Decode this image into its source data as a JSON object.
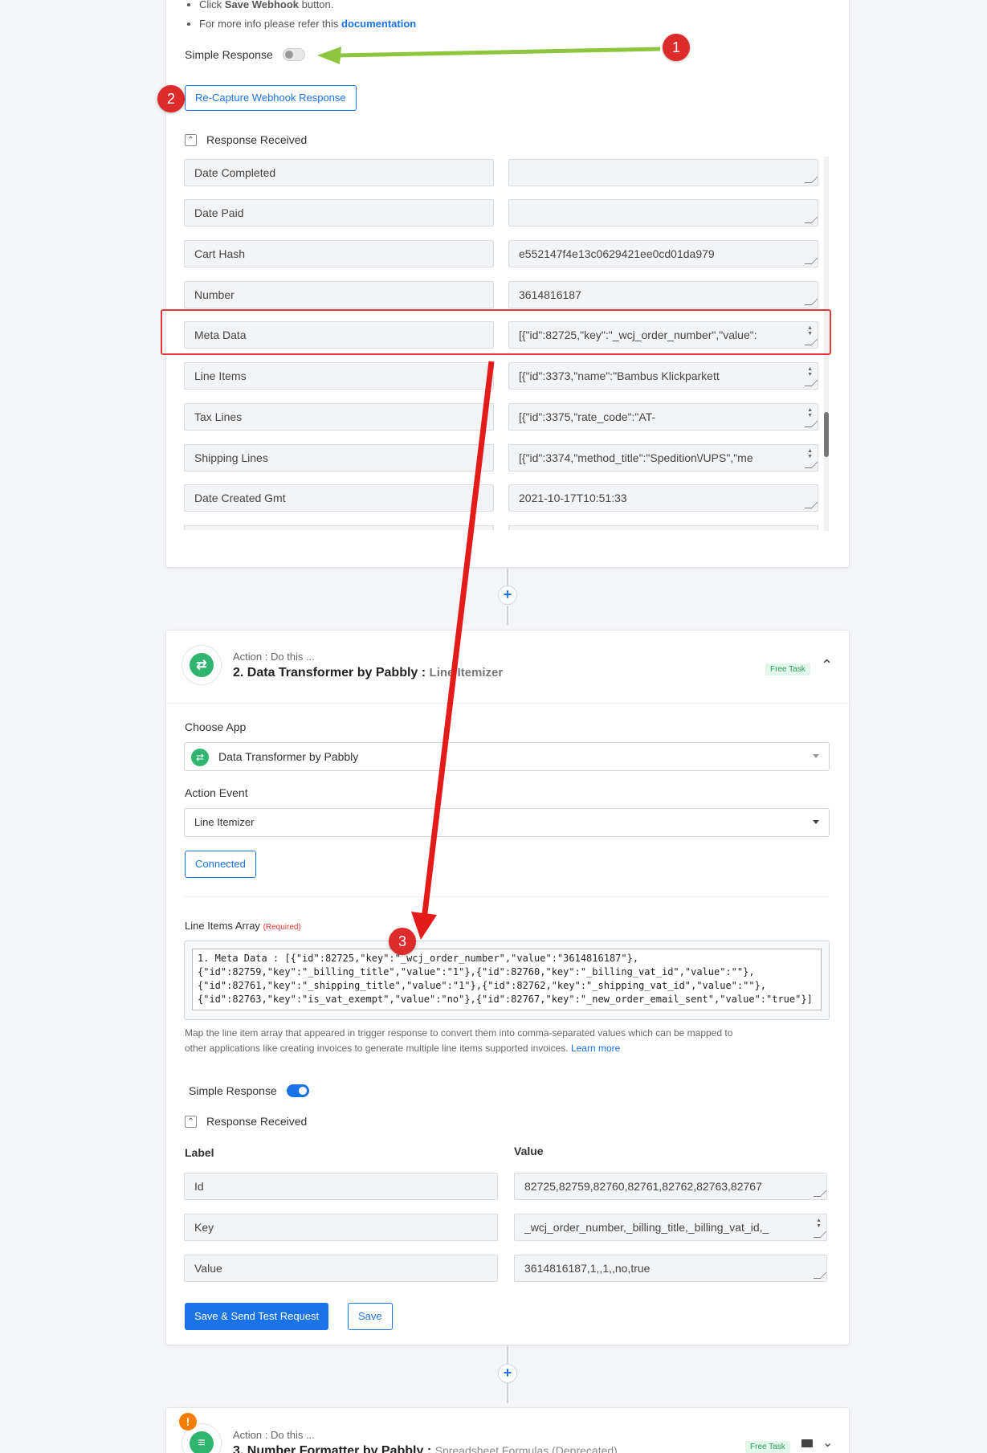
{
  "card1": {
    "bullets": [
      {
        "prefix": "Click ",
        "bold": "Save Webhook",
        "suffix": " button."
      },
      {
        "prefix": "For more info please refer this ",
        "link": "documentation"
      }
    ],
    "simple_response_label": "Simple Response",
    "simple_response_on": false,
    "recapture_button": "Re-Capture Webhook Response",
    "response_received_label": "Response Received",
    "fields": [
      {
        "label": "Date Completed",
        "value": ""
      },
      {
        "label": "Date Paid",
        "value": ""
      },
      {
        "label": "Cart Hash",
        "value": "e552147f4e13c0629421ee0cd01da979"
      },
      {
        "label": "Number",
        "value": "3614816187"
      },
      {
        "label": "Meta Data",
        "value": "[{\"id\":82725,\"key\":\"_wcj_order_number\",\"value\":"
      },
      {
        "label": "Line Items",
        "value": "[{\"id\":3373,\"name\":\"Bambus Klickparkett"
      },
      {
        "label": "Tax Lines",
        "value": "[{\"id\":3375,\"rate_code\":\"AT-"
      },
      {
        "label": "Shipping Lines",
        "value": "[{\"id\":3374,\"method_title\":\"Spedition\\/UPS\",\"me"
      },
      {
        "label": "Date Created Gmt",
        "value": "2021-10-17T10:51:33"
      }
    ]
  },
  "annotations": {
    "one": "1",
    "two": "2",
    "three": "3"
  },
  "action2": {
    "pre_title": "Action : Do this ...",
    "title_bold": "2. Data Transformer by Pabbly : ",
    "title_event": "Line Itemizer",
    "badge": "Free Task",
    "choose_app_label": "Choose App",
    "choose_app_value": "Data Transformer by Pabbly",
    "action_event_label": "Action Event",
    "action_event_value": "Line Itemizer",
    "connected_button": "Connected",
    "line_items_label": "Line Items Array",
    "required": "(Required)",
    "line_items_value": [
      "1. Meta Data : [{\"id\":82725,\"key\":\"_wcj_order_number\",\"value\":\"3614816187\"},",
      "{\"id\":82759,\"key\":\"_billing_title\",\"value\":\"1\"},{\"id\":82760,\"key\":\"_billing_vat_id\",\"value\":\"\"},",
      "{\"id\":82761,\"key\":\"_shipping_title\",\"value\":\"1\"},{\"id\":82762,\"key\":\"_shipping_vat_id\",\"value\":\"\"},",
      "{\"id\":82763,\"key\":\"is_vat_exempt\",\"value\":\"no\"},{\"id\":82767,\"key\":\"_new_order_email_sent\",\"value\":\"true\"}]"
    ],
    "help_text_1": "Map the line item array that appeared in trigger response to convert them into comma-separated values which can be mapped to",
    "help_text_2": "other applications like creating invoices to generate multiple line items supported invoices.",
    "learn_more": "Learn more",
    "simple_response_label": "Simple Response",
    "simple_response_on": true,
    "response_received_label": "Response Received",
    "label_header": "Label",
    "value_header": "Value",
    "rows": [
      {
        "label": "Id",
        "value": "82725,82759,82760,82761,82762,82763,82767"
      },
      {
        "label": "Key",
        "value": "_wcj_order_number,_billing_title,_billing_vat_id,_"
      },
      {
        "label": "Value",
        "value": "3614816187,1,,1,,no,true"
      }
    ],
    "save_send_button": "Save & Send Test Request",
    "save_button": "Save"
  },
  "action3": {
    "pre_title": "Action : Do this ...",
    "title_bold": "3. Number Formatter by Pabbly : ",
    "title_event": "Spreadsheet Formulas (Deprecated)",
    "badge": "Free Task"
  },
  "colors": {
    "accent": "#1a73e8",
    "annotation_red": "#dd2a2a",
    "arrow_green": "#8cc63f",
    "app_green": "#2fb56f"
  }
}
